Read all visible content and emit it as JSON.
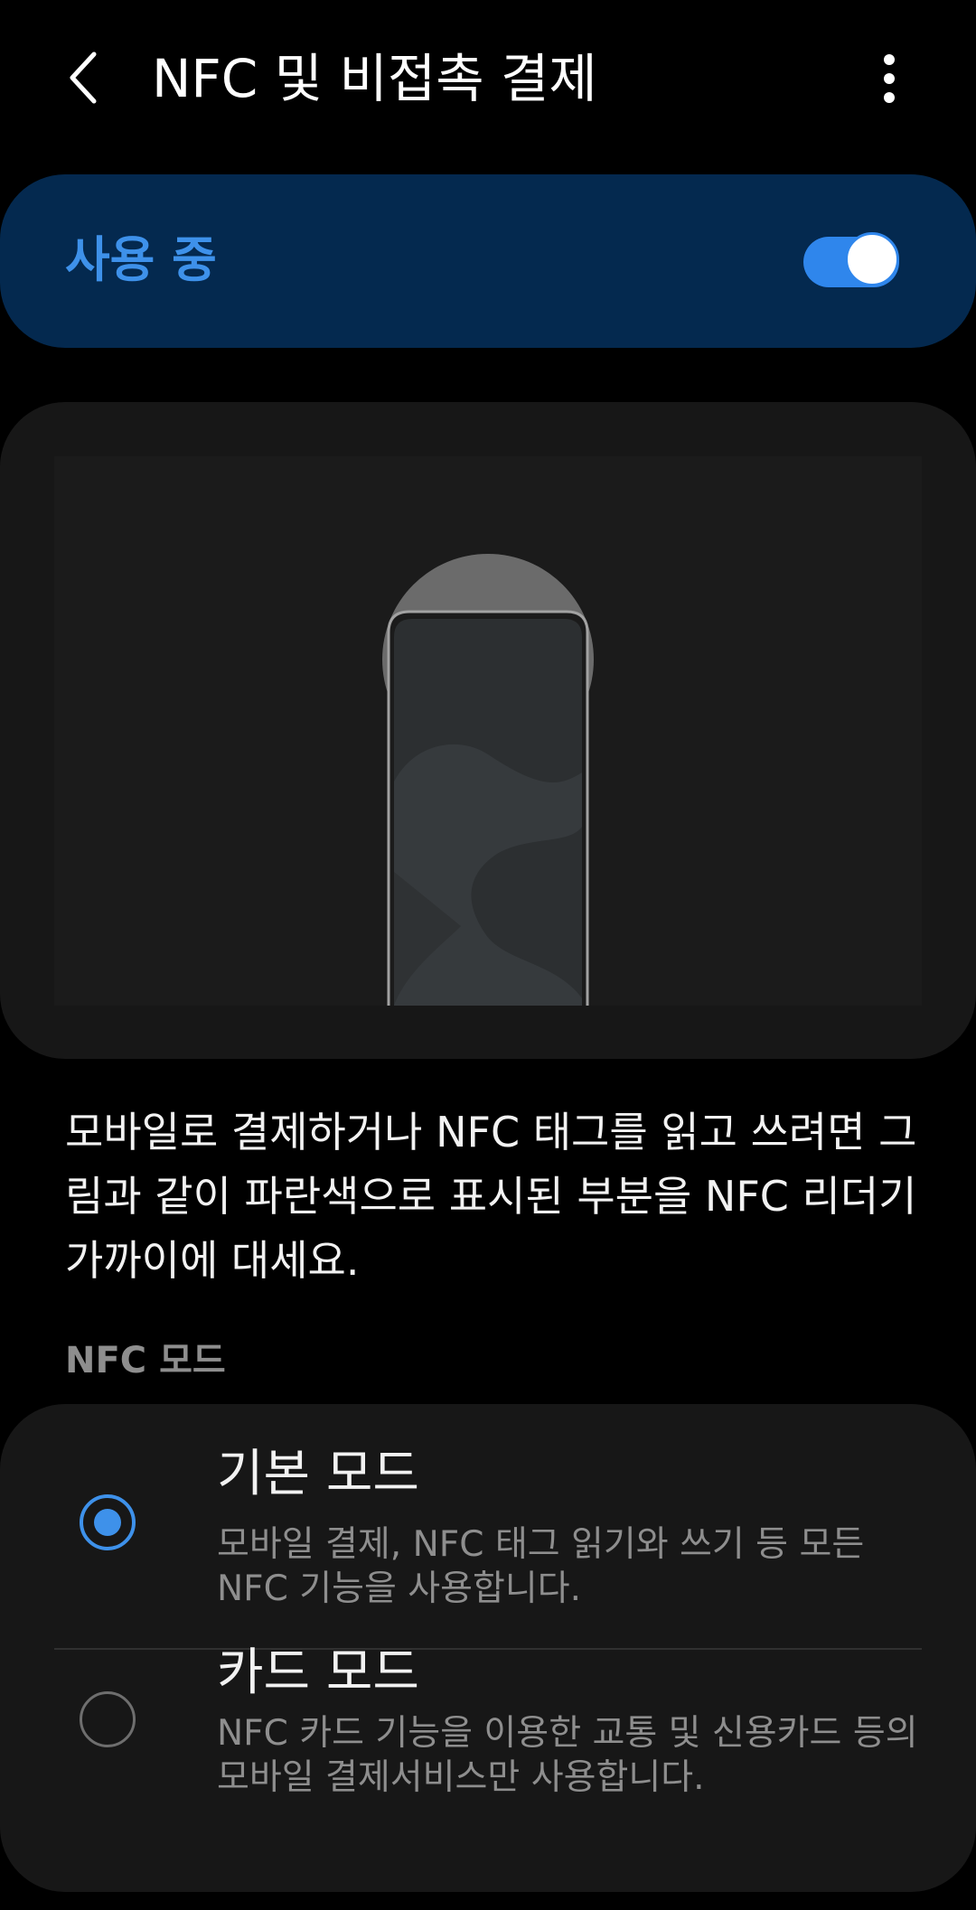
{
  "header": {
    "title": "NFC 및 비접촉 결제",
    "back_icon": "chevron-left-icon",
    "more_icon": "more-vertical-icon"
  },
  "master_switch": {
    "label": "사용 중",
    "state": "on",
    "accent_color": "#3e91ea",
    "background_color": "#04294f"
  },
  "illustration": {
    "subject": "phone-nfc-area"
  },
  "instruction": "모바일로 결제하거나 NFC 태그를 읽고 쓰려면 그림과 같이 파란색으로 표시된 부분을 NFC 리더기 가까이에 대세요.",
  "nfc_mode": {
    "section_title": "NFC 모드",
    "options": [
      {
        "title": "기본 모드",
        "description": "모바일 결제, NFC 태그 읽기와 쓰기 등 모든 NFC 기능을 사용합니다.",
        "selected": true
      },
      {
        "title": "카드 모드",
        "description": "NFC 카드 기능을 이용한 교통 및 신용카드 등의 모바일 결제서비스만 사용합니다.",
        "selected": false
      }
    ]
  }
}
